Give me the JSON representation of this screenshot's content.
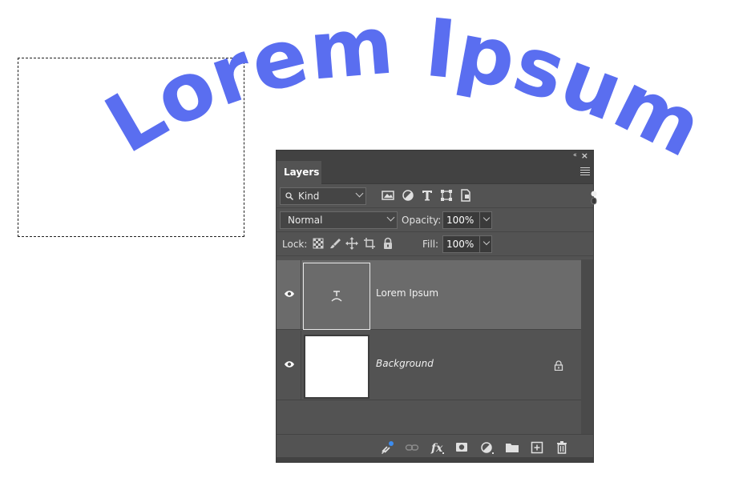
{
  "canvas": {
    "warped_text": "Lorem Ipsum",
    "text_color": "#5a6ef0"
  },
  "panel": {
    "tab_label": "Layers",
    "filter": {
      "kind_label": "Kind",
      "icons": [
        "image-filter-icon",
        "adjustment-filter-icon",
        "type-filter-icon",
        "shape-filter-icon",
        "smart-object-filter-icon"
      ]
    },
    "blend_mode": "Normal",
    "opacity_label": "Opacity:",
    "opacity_value": "100%",
    "lock_label": "Lock:",
    "fill_label": "Fill:",
    "fill_value": "100%",
    "layers": [
      {
        "name": "Lorem Ipsum",
        "type": "text",
        "selected": true,
        "visible": true
      },
      {
        "name": "Background",
        "type": "background",
        "selected": false,
        "visible": true,
        "locked": true
      }
    ],
    "bottom_icons": [
      "link-layers-icon",
      "layer-style-fx-icon",
      "add-mask-icon",
      "new-adjustment-layer-icon",
      "new-group-icon",
      "new-layer-icon",
      "delete-layer-icon"
    ]
  }
}
